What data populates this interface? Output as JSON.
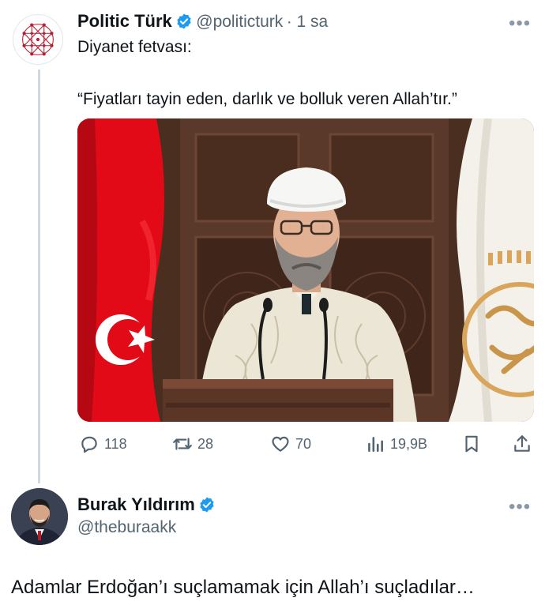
{
  "tweet": {
    "author_name": "Politic Türk",
    "handle": "@politicturk",
    "time": "· 1 sa",
    "text_line1": "Diyanet fetvası:",
    "text_line2": "“Fiyatları tayin eden, darlık ve bolluk veren Allah’tır.”",
    "actions": {
      "replies": "118",
      "retweets": "28",
      "likes": "70",
      "views": "19,9B"
    },
    "more": "•••"
  },
  "reply": {
    "author_name": "Burak Yıldırım",
    "handle": "@theburaakk",
    "text": "Adamlar Erdoğan’ı suçlamamak için Allah’ı suçladılar…",
    "more": "•••"
  },
  "colors": {
    "verified": "#1d9bf0",
    "text": "#0f1419",
    "muted": "#536471",
    "thread_line": "#cfd9de",
    "flag_red": "#e30a17"
  },
  "icons": [
    "reply-icon",
    "retweet-icon",
    "like-icon",
    "views-icon",
    "bookmark-icon",
    "share-icon",
    "verified-badge-icon",
    "more-icon"
  ]
}
